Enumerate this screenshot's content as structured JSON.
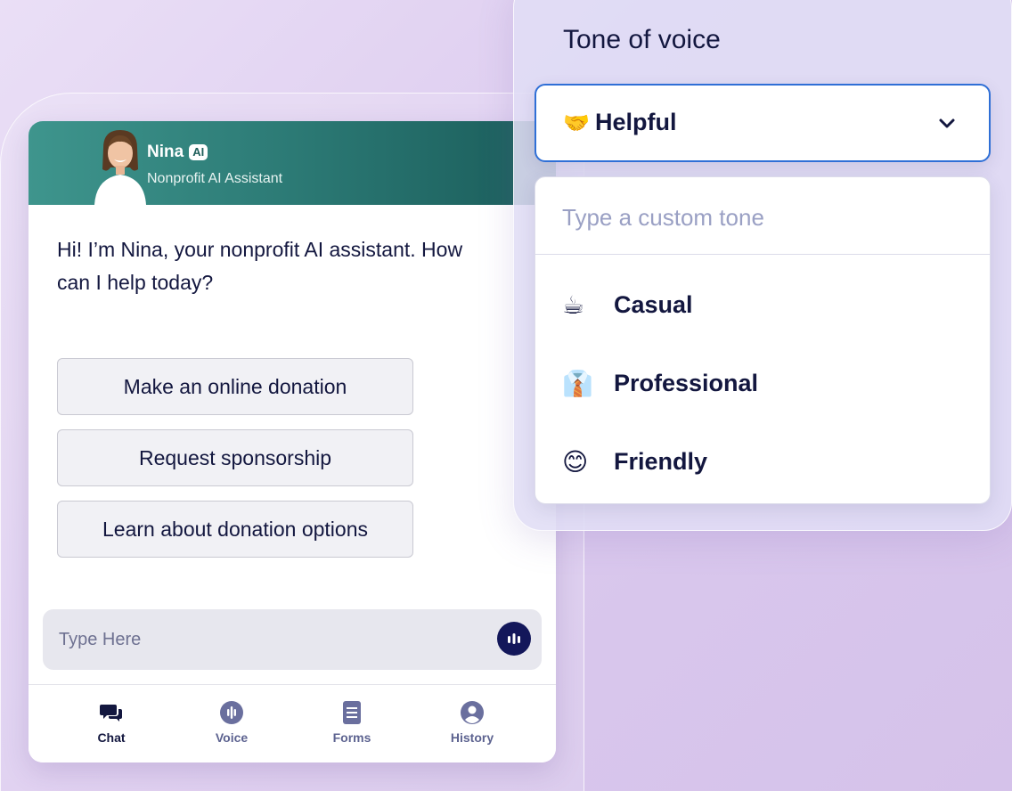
{
  "chat": {
    "agent_name": "Nina",
    "ai_badge": "AI",
    "agent_subtitle": "Nonprofit AI Assistant",
    "greeting": "Hi! I’m Nina, your nonprofit AI assistant. How can I help today?",
    "options": [
      "Make an online donation",
      "Request sponsorship",
      "Learn about donation options"
    ],
    "input_placeholder": "Type Here",
    "nav": [
      {
        "label": "Chat",
        "icon": "chat-bubbles-icon",
        "active": true
      },
      {
        "label": "Voice",
        "icon": "voice-icon",
        "active": false
      },
      {
        "label": "Forms",
        "icon": "forms-icon",
        "active": false
      },
      {
        "label": "History",
        "icon": "user-history-icon",
        "active": false
      }
    ]
  },
  "tone": {
    "title": "Tone of voice",
    "selected": {
      "emoji": "🤝",
      "label": "Helpful"
    },
    "custom_placeholder": "Type a custom tone",
    "options": [
      {
        "emoji": "☕",
        "label": "Casual"
      },
      {
        "emoji": "👔",
        "label": "Professional"
      },
      {
        "emoji": "😊",
        "label": "Friendly"
      }
    ]
  },
  "colors": {
    "header_teal": "#2c7a75",
    "navy": "#13173f",
    "focus_blue": "#2f6fd6"
  }
}
